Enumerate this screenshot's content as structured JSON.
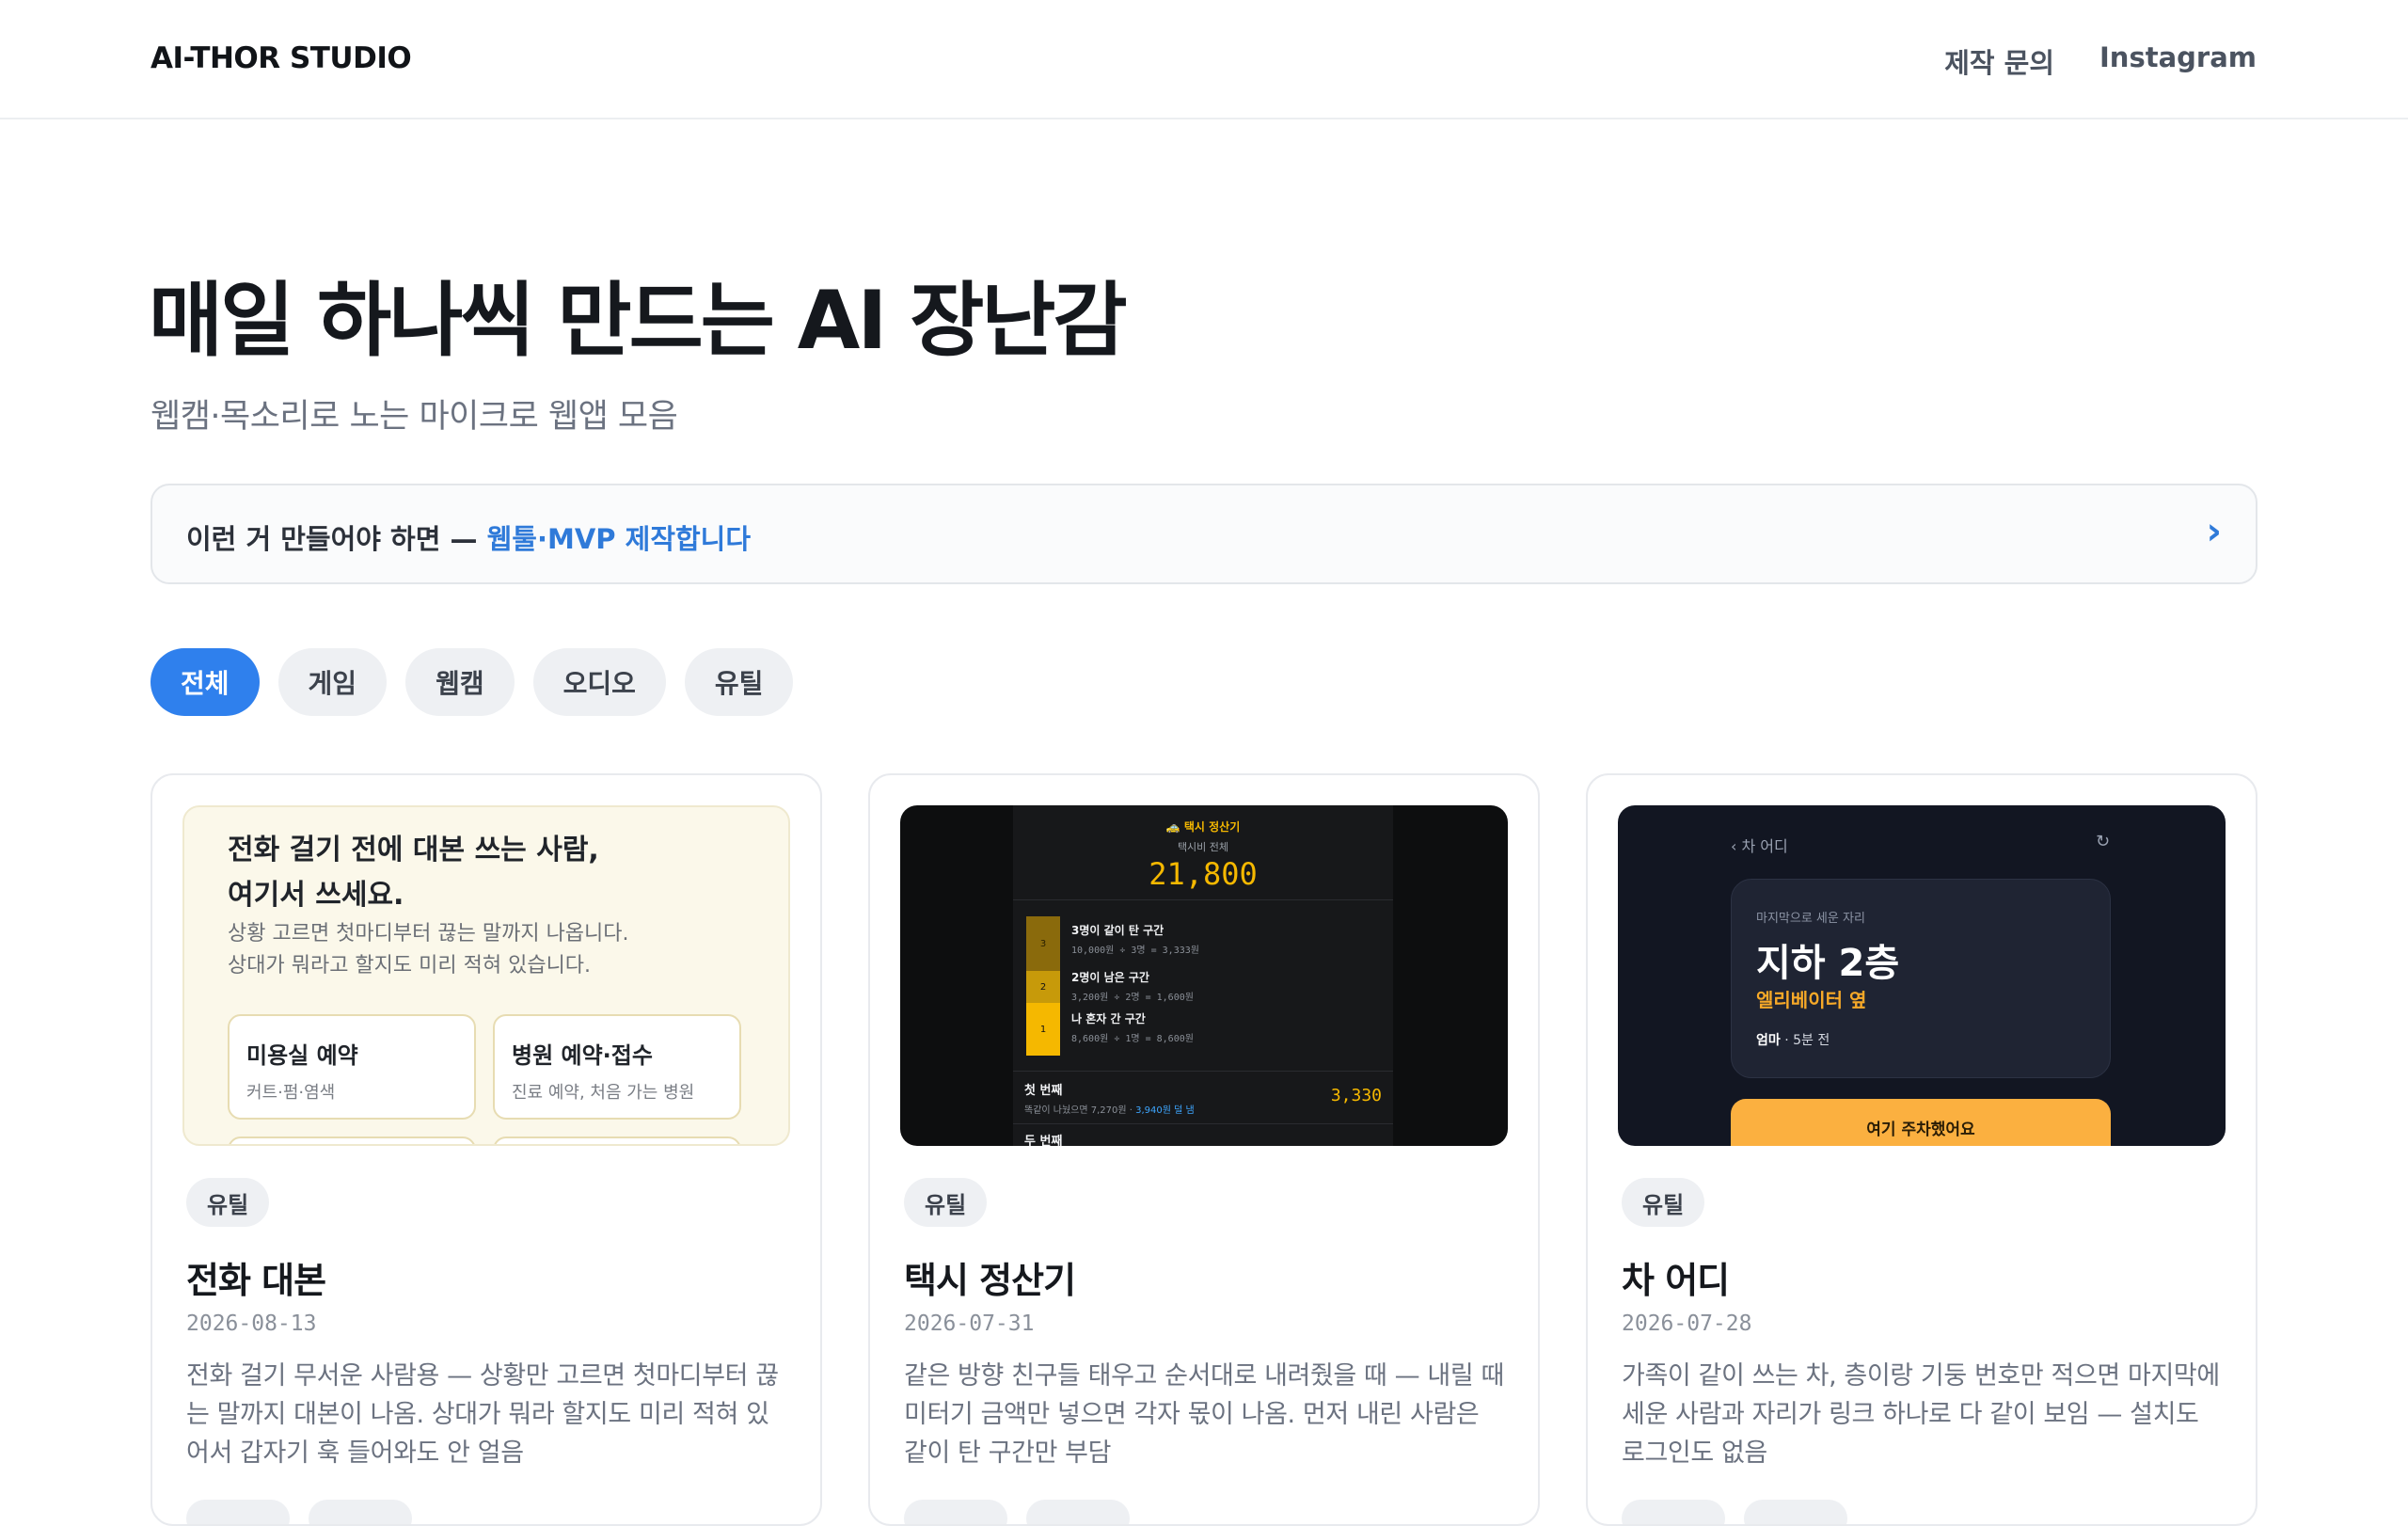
{
  "header": {
    "brand": "AI-THOR STUDIO",
    "nav": [
      "제작 문의",
      "Instagram"
    ]
  },
  "hero": {
    "title": "매일 하나씩 만드는 AI 장난감",
    "subtitle": "웹캠·목소리로 노는 마이크로 웹앱 모음"
  },
  "banner": {
    "text": "이런 거 만들어야 하면 — ",
    "link": "웹툴·MVP 제작합니다",
    "chevron": "›"
  },
  "filters": [
    "전체",
    "게임",
    "웹캠",
    "오디오",
    "유틸"
  ],
  "cards": [
    {
      "tag": "유틸",
      "title": "전화 대본",
      "date": "2026-08-13",
      "desc": "전화 걸기 무서운 사람용 — 상황만 고르면 첫마디부터 끊는 말까지 대본이 나옴. 상대가 뭐라 할지도 미리 적혀 있어서 갑자기 훅 들어와도 안 얼음",
      "thumb": {
        "heading1": "전화 걸기 전에 대본 쓰는 사람,",
        "heading2": "여기서 쓰세요.",
        "sub1": "상황 고르면 첫마디부터 끊는 말까지 나옵니다.",
        "sub2": "상대가 뭐라고 할지도 미리 적혀 있습니다.",
        "options": [
          {
            "title": "미용실 예약",
            "sub": "커트·펌·염색"
          },
          {
            "title": "병원 예약·접수",
            "sub": "진료 예약, 처음 가는 병원"
          }
        ]
      }
    },
    {
      "tag": "유틸",
      "title": "택시 정산기",
      "date": "2026-07-31",
      "desc": "같은 방향 친구들 태우고 순서대로 내려줬을 때 — 내릴 때 미터기 금액만 넣으면 각자 몫이 나옴. 먼저 내린 사람은 같이 탄 구간만 부담",
      "thumb": {
        "head": "🚕 택시 정산기",
        "caption": "택시비 전체",
        "total": "21,800",
        "bars": [
          "3",
          "2",
          "1"
        ],
        "rows": [
          {
            "a": "3명이 같이 탄 구간",
            "b": "10,000원 ÷ 3명 = 3,333원"
          },
          {
            "a": "2명이 남은 구간",
            "b": "3,200원 ÷ 2명 = 1,600원"
          },
          {
            "a": "나 혼자 간 구간",
            "b": "8,600원 ÷ 1명 = 8,600원"
          }
        ],
        "first_label": "첫 번째",
        "first_note": "똑같이 나눴으면 7,270원 · ",
        "first_note_em": "3,940원 덜 냄",
        "first_value": "3,330",
        "second_label": "두 번째"
      }
    },
    {
      "tag": "유틸",
      "title": "차 어디",
      "date": "2026-07-28",
      "desc": "가족이 같이 쓰는 차, 층이랑 기둥 번호만 적으면 마지막에 세운 사람과 자리가 링크 하나로 다 같이 보임 — 설치도 로그인도 없음",
      "thumb": {
        "back": "‹ 차 어디",
        "refresh": "↻",
        "caption": "마지막으로 세운 자리",
        "floor": "지하 2층",
        "spot": "엘리베이터 옆",
        "who": "엄마",
        "when": " · 5분 전",
        "button": "여기 주차했어요"
      }
    }
  ],
  "colors": {
    "accent": "#2f80ed",
    "taxi_yellow": "#f5b800",
    "parking_orange": "#fbb040"
  }
}
